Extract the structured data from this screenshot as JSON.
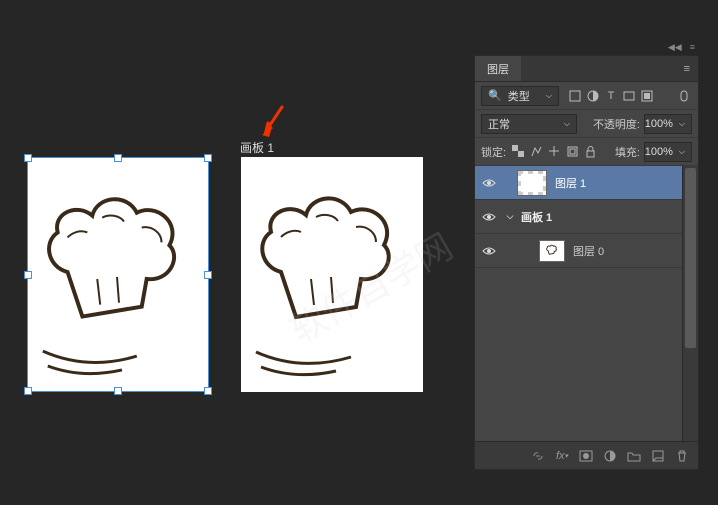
{
  "canvas": {
    "artboard_label": "画板 1",
    "watermark": "软件自学网"
  },
  "panel": {
    "tab_label": "图层",
    "filter_label": "类型",
    "blend_mode": "正常",
    "opacity_label": "不透明度:",
    "opacity_value": "100%",
    "lock_label": "锁定:",
    "fill_label": "填充:",
    "fill_value": "100%",
    "layers": [
      {
        "name": "图层 1",
        "selected": true,
        "type": "layer",
        "thumb": "checker"
      },
      {
        "name": "画板 1",
        "selected": false,
        "type": "artboard"
      },
      {
        "name": "图层 0",
        "selected": false,
        "type": "layer",
        "thumb": "hat",
        "indent": true
      }
    ]
  }
}
